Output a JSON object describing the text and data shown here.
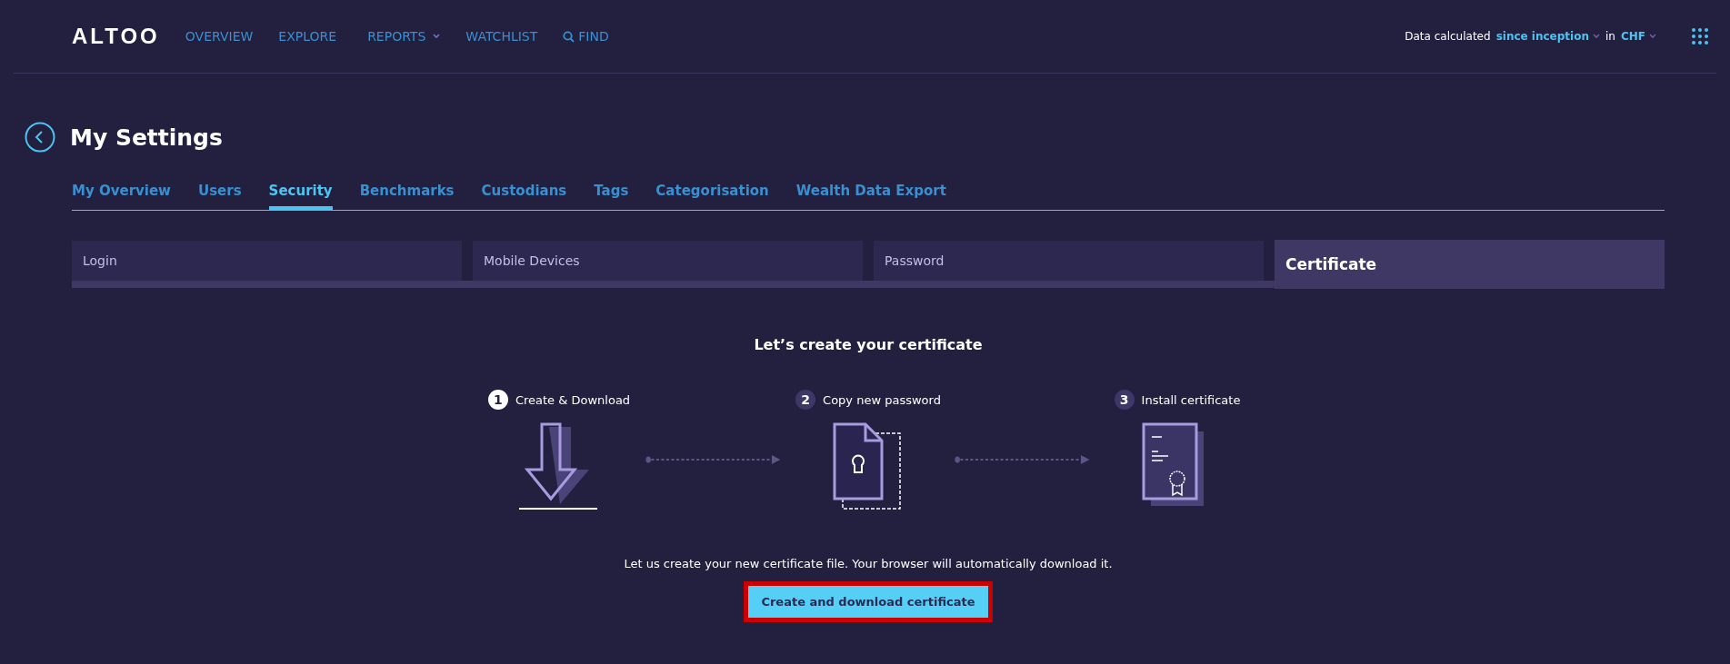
{
  "brand": "ALTOO",
  "nav": [
    {
      "label": "OVERVIEW",
      "kind": "link"
    },
    {
      "label": "EXPLORE",
      "kind": "link"
    },
    {
      "label": "REPORTS",
      "kind": "dropdown"
    },
    {
      "label": "WATCHLIST",
      "kind": "link"
    },
    {
      "label": "FIND",
      "kind": "search"
    }
  ],
  "data_selector": {
    "prefix": "Data calculated",
    "period": "since inception",
    "joiner": "in",
    "currency": "CHF"
  },
  "page_title": "My Settings",
  "tabs": [
    {
      "label": "My Overview",
      "selected": false
    },
    {
      "label": "Users",
      "selected": false
    },
    {
      "label": "Security",
      "selected": true
    },
    {
      "label": "Benchmarks",
      "selected": false
    },
    {
      "label": "Custodians",
      "selected": false
    },
    {
      "label": "Tags",
      "selected": false
    },
    {
      "label": "Categorisation",
      "selected": false
    },
    {
      "label": "Wealth Data Export",
      "selected": false
    }
  ],
  "subtabs": [
    {
      "label": "Login",
      "selected": false
    },
    {
      "label": "Mobile Devices",
      "selected": false
    },
    {
      "label": "Password",
      "selected": false
    },
    {
      "label": "Certificate",
      "selected": true
    }
  ],
  "heading": "Let’s create your certificate",
  "steps": [
    {
      "number": "1",
      "label": "Create & Download",
      "kind": "download",
      "active": true
    },
    {
      "number": "2",
      "label": "Copy new password",
      "kind": "password",
      "active": false
    },
    {
      "number": "3",
      "label": "Install certificate",
      "kind": "certificate",
      "active": false
    }
  ],
  "description": "Let us create your new certificate file. Your browser will automatically download it.",
  "button": {
    "label": "Create and download certificate",
    "highlighted": true
  }
}
